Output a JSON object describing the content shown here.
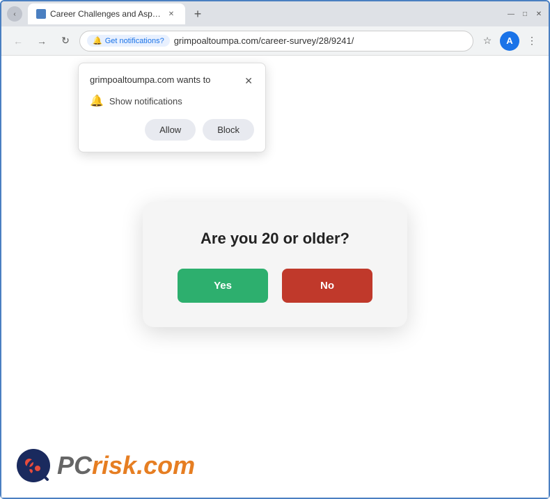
{
  "browser": {
    "tab_title": "Career Challenges and Aspirati…",
    "tab_favicon": "page-icon",
    "url": "grimpoaltoumpa.com/career-survey/28/9241/",
    "notif_pill_label": "Get notifications?",
    "nav": {
      "back_arrow": "←",
      "forward_arrow": "→",
      "refresh": "↻",
      "star": "☆",
      "menu": "⋮"
    },
    "window_controls": {
      "minimize": "—",
      "maximize": "□",
      "close": "✕"
    }
  },
  "notification_popup": {
    "title": "grimpoaltoumpa.com wants to",
    "close_icon": "✕",
    "bell_icon": "🔔",
    "body_text": "Show notifications",
    "allow_label": "Allow",
    "block_label": "Block"
  },
  "age_modal": {
    "title": "Are you 20 or older?",
    "yes_label": "Yes",
    "no_label": "No"
  },
  "pcrisk": {
    "pc_text": "PC",
    "risk_text": "risk",
    "dotcom_text": ".com"
  }
}
